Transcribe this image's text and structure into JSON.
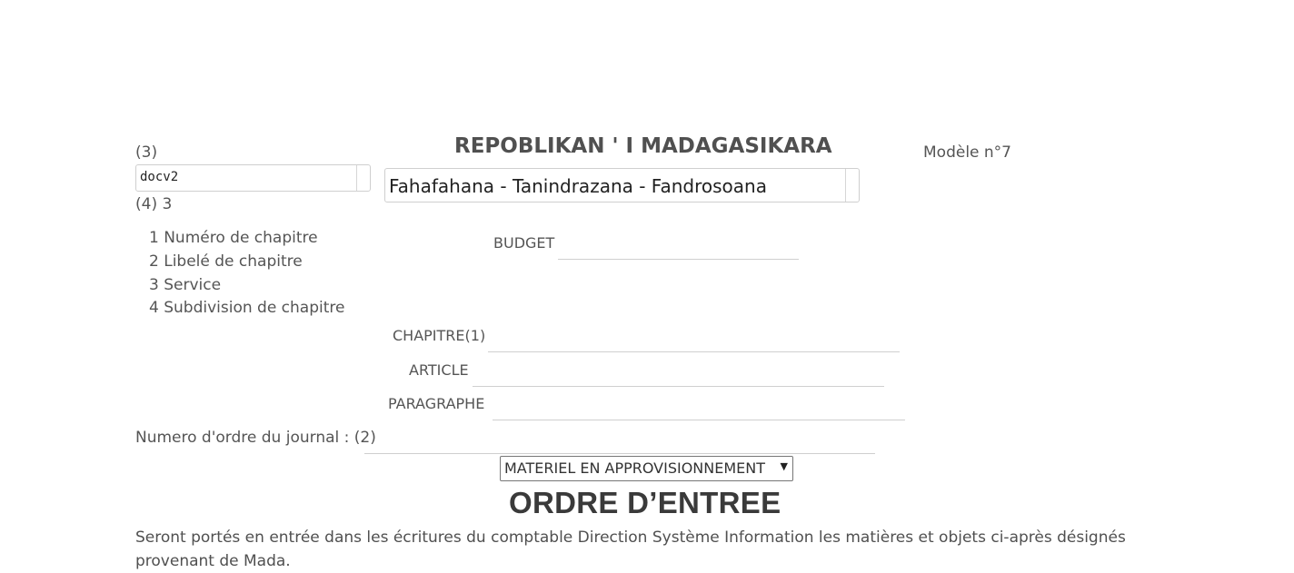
{
  "header": {
    "ref3_label": "(3)",
    "ref3_value": "docv2",
    "ref4_label": "(4) 3",
    "republic_title": "REPOBLIKAN ' I MADAGASIKARA",
    "motto": "Fahafahana - Tanindrazana - Fandrosoana",
    "model_label": "Modèle n°7"
  },
  "legend": {
    "items": [
      "1 Numéro de chapitre",
      "2 Libelé de chapitre",
      "3 Service",
      "4 Subdivision de chapitre"
    ]
  },
  "form": {
    "budget_label": "BUDGET",
    "budget_value": "",
    "chapitre_label": "CHAPITRE(1)",
    "chapitre_value": "",
    "article_label": "ARTICLE",
    "article_value": "",
    "paragraphe_label": "PARAGRAPHE",
    "paragraphe_value": "",
    "journal_label": "Numero d'ordre du journal : (2)",
    "journal_value": "",
    "category_select": "MATERIEL EN APPROVISIONNEMENT"
  },
  "main": {
    "document_title": "ORDRE D’ENTREE",
    "description": "Seront portés en entrée dans les écritures du comptable Direction Système Information les matières et objets ci-après désignés provenant de Mada."
  }
}
